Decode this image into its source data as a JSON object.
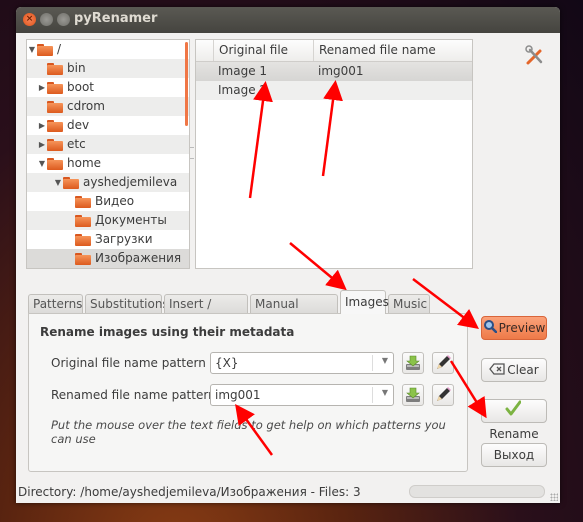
{
  "window": {
    "title": "pyRenamer",
    "controls": {
      "close": "×",
      "minimize": "–",
      "maximize": "□"
    }
  },
  "tree": {
    "items": [
      {
        "label": "/",
        "expander": "expanded",
        "depth": 0
      },
      {
        "label": "bin",
        "expander": "none",
        "depth": 1
      },
      {
        "label": "boot",
        "expander": "collapsed",
        "depth": 1
      },
      {
        "label": "cdrom",
        "expander": "none",
        "depth": 1
      },
      {
        "label": "dev",
        "expander": "collapsed",
        "depth": 1
      },
      {
        "label": "etc",
        "expander": "collapsed",
        "depth": 1
      },
      {
        "label": "home",
        "expander": "expanded",
        "depth": 1
      },
      {
        "label": "ayshedjemileva",
        "expander": "expanded",
        "depth": 2
      },
      {
        "label": "Видео",
        "expander": "none",
        "depth": 3
      },
      {
        "label": "Документы",
        "expander": "none",
        "depth": 3
      },
      {
        "label": "Загрузки",
        "expander": "none",
        "depth": 3
      },
      {
        "label": "Изображения",
        "expander": "none",
        "depth": 3,
        "selected": true
      }
    ]
  },
  "file_table": {
    "columns": [
      "Original file name",
      "Renamed file name"
    ],
    "rows": [
      {
        "original": "Image 1",
        "renamed": "img001",
        "selected": true
      },
      {
        "original": "Image 2",
        "renamed": ""
      }
    ]
  },
  "tabs": {
    "items": [
      "Patterns",
      "Substitutions",
      "Insert / Delete",
      "Manual rename",
      "Images",
      "Music"
    ],
    "active": "Images"
  },
  "images_tab": {
    "section_title": "Rename images using their metadata",
    "original_pattern_label": "Original file name pattern",
    "original_pattern_value": "{X}",
    "renamed_pattern_label": "Renamed file name pattern",
    "renamed_pattern_value": "img001",
    "hint": "Put the mouse over the text fields to get help on which patterns you can use"
  },
  "buttons": {
    "preview": "Preview",
    "clear": "Clear",
    "rename": "Rename",
    "exit": "Выход"
  },
  "statusbar": {
    "text": "Directory: /home/ayshedjemileva/Изображения - Files: 3",
    "progress": 0
  },
  "colors": {
    "accent": "#f07746",
    "annotation_arrow": "#ff0000",
    "titlebar": "#4f4e49"
  }
}
